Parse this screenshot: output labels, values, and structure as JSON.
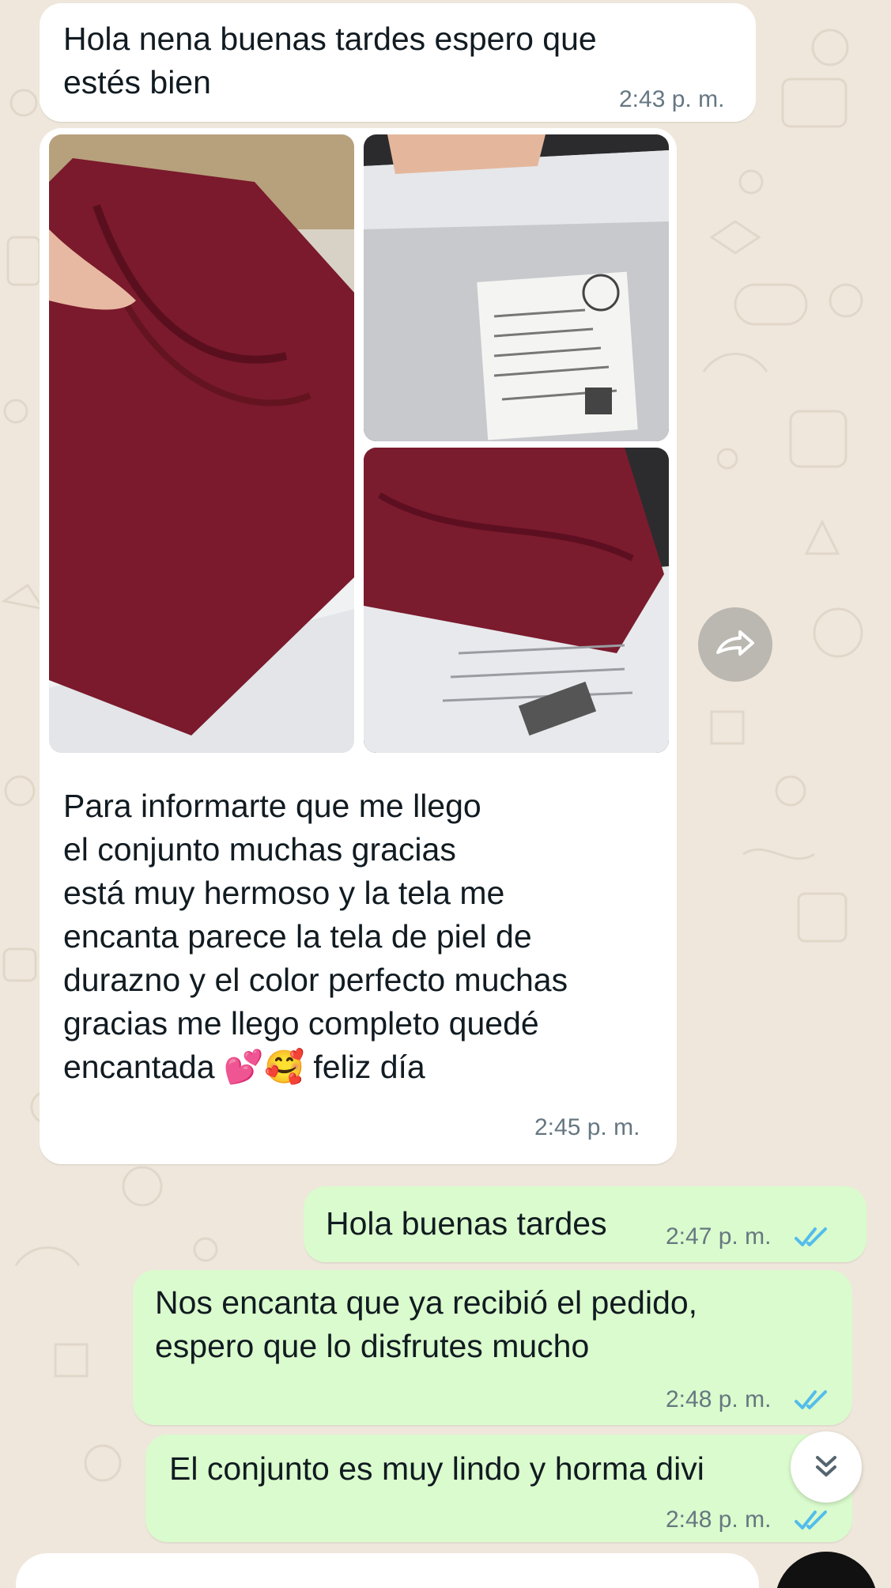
{
  "chat": {
    "messages": [
      {
        "direction": "incoming",
        "text": "Hola nena buenas tardes espero que\nestés bien",
        "time": "2:43 p. m."
      },
      {
        "direction": "incoming",
        "type": "photo-album",
        "photos": [
          {
            "description": "burgundy-garment-photo"
          },
          {
            "description": "shipping-package-photo"
          },
          {
            "description": "folded-garment-on-package-photo"
          }
        ],
        "text": "Para informarte que me llego\nel conjunto muchas gracias\nestá muy hermoso y la tela me\nencanta parece la tela de piel de\ndurazno y el color perfecto muchas\ngracias me llego completo quedé\nencantada 💕🥰 feliz día",
        "time": "2:45 p. m."
      },
      {
        "direction": "outgoing",
        "text": "Hola buenas tardes",
        "time": "2:47 p. m.",
        "status": "read"
      },
      {
        "direction": "outgoing",
        "text": "Nos encanta que ya recibió el pedido,\nespero que lo disfrutes mucho",
        "time": "2:48 p. m.",
        "status": "read"
      },
      {
        "direction": "outgoing",
        "text": "El conjunto es muy lindo y horma divi",
        "time": "2:48 p. m.",
        "status": "read"
      }
    ]
  },
  "colors": {
    "wallpaper": "#efe7dc",
    "incoming_bubble": "#ffffff",
    "outgoing_bubble": "#dafbcd",
    "read_ticks": "#53bdeb",
    "timestamp": "#667781"
  },
  "icons": {
    "forward": "forward-icon",
    "scroll_down": "double-chevron-down-icon",
    "read_receipt": "double-check-icon"
  }
}
